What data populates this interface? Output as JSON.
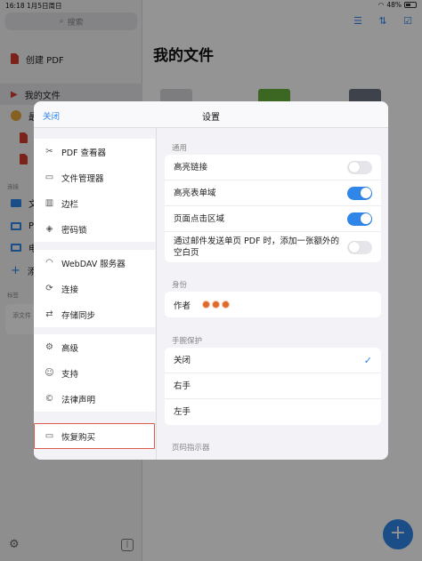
{
  "status_bar": {
    "time": "16:18",
    "date": "1月5日周日",
    "battery": "48%"
  },
  "sidebar": {
    "search_placeholder": "搜索",
    "create_pdf": "创建 PDF",
    "my_files": "我的文件",
    "recent": "最",
    "section_links": "连接",
    "row_files": "文",
    "row_pc": "PI",
    "row_computer": "电",
    "row_add": "添",
    "section_tags": "标签",
    "tags_placeholder": "添文件"
  },
  "main": {
    "title": "我的文件"
  },
  "modal": {
    "title": "设置",
    "close_label": "关闭",
    "menu": [
      {
        "label": "PDF 查看器",
        "icon": "pdf-viewer-icon"
      },
      {
        "label": "文件管理器",
        "icon": "folder-icon"
      },
      {
        "label": "边栏",
        "icon": "sidebar-icon"
      },
      {
        "label": "密码锁",
        "icon": "passcode-icon"
      },
      {
        "label": "WebDAV 服务器",
        "icon": "wifi-icon"
      },
      {
        "label": "连接",
        "icon": "link-icon"
      },
      {
        "label": "存储同步",
        "icon": "sync-icon"
      },
      {
        "label": "高级",
        "icon": "advanced-gears-icon"
      },
      {
        "label": "支持",
        "icon": "support-icon"
      },
      {
        "label": "法律声明",
        "icon": "copyright-icon"
      },
      {
        "label": "恢复购买",
        "icon": "restore-icon"
      }
    ],
    "general": {
      "header": "通用",
      "rows": [
        {
          "label": "高亮链接",
          "on": false
        },
        {
          "label": "高亮表单域",
          "on": true
        },
        {
          "label": "页面点击区域",
          "on": true
        },
        {
          "label": "通过邮件发送单页 PDF 时，添加一张额外的空白页",
          "on": false
        }
      ]
    },
    "identity": {
      "header": "身份",
      "author_label": "作者"
    },
    "palm": {
      "header": "手腕保护",
      "options": [
        {
          "label": "关闭",
          "selected": true
        },
        {
          "label": "右手",
          "selected": false
        },
        {
          "label": "左手",
          "selected": false
        }
      ]
    },
    "page_indicator_header": "页码指示器"
  },
  "colors": {
    "accent": "#2f86e8",
    "highlight_outline": "#d95a4a",
    "pdf_red": "#d43b2f"
  }
}
